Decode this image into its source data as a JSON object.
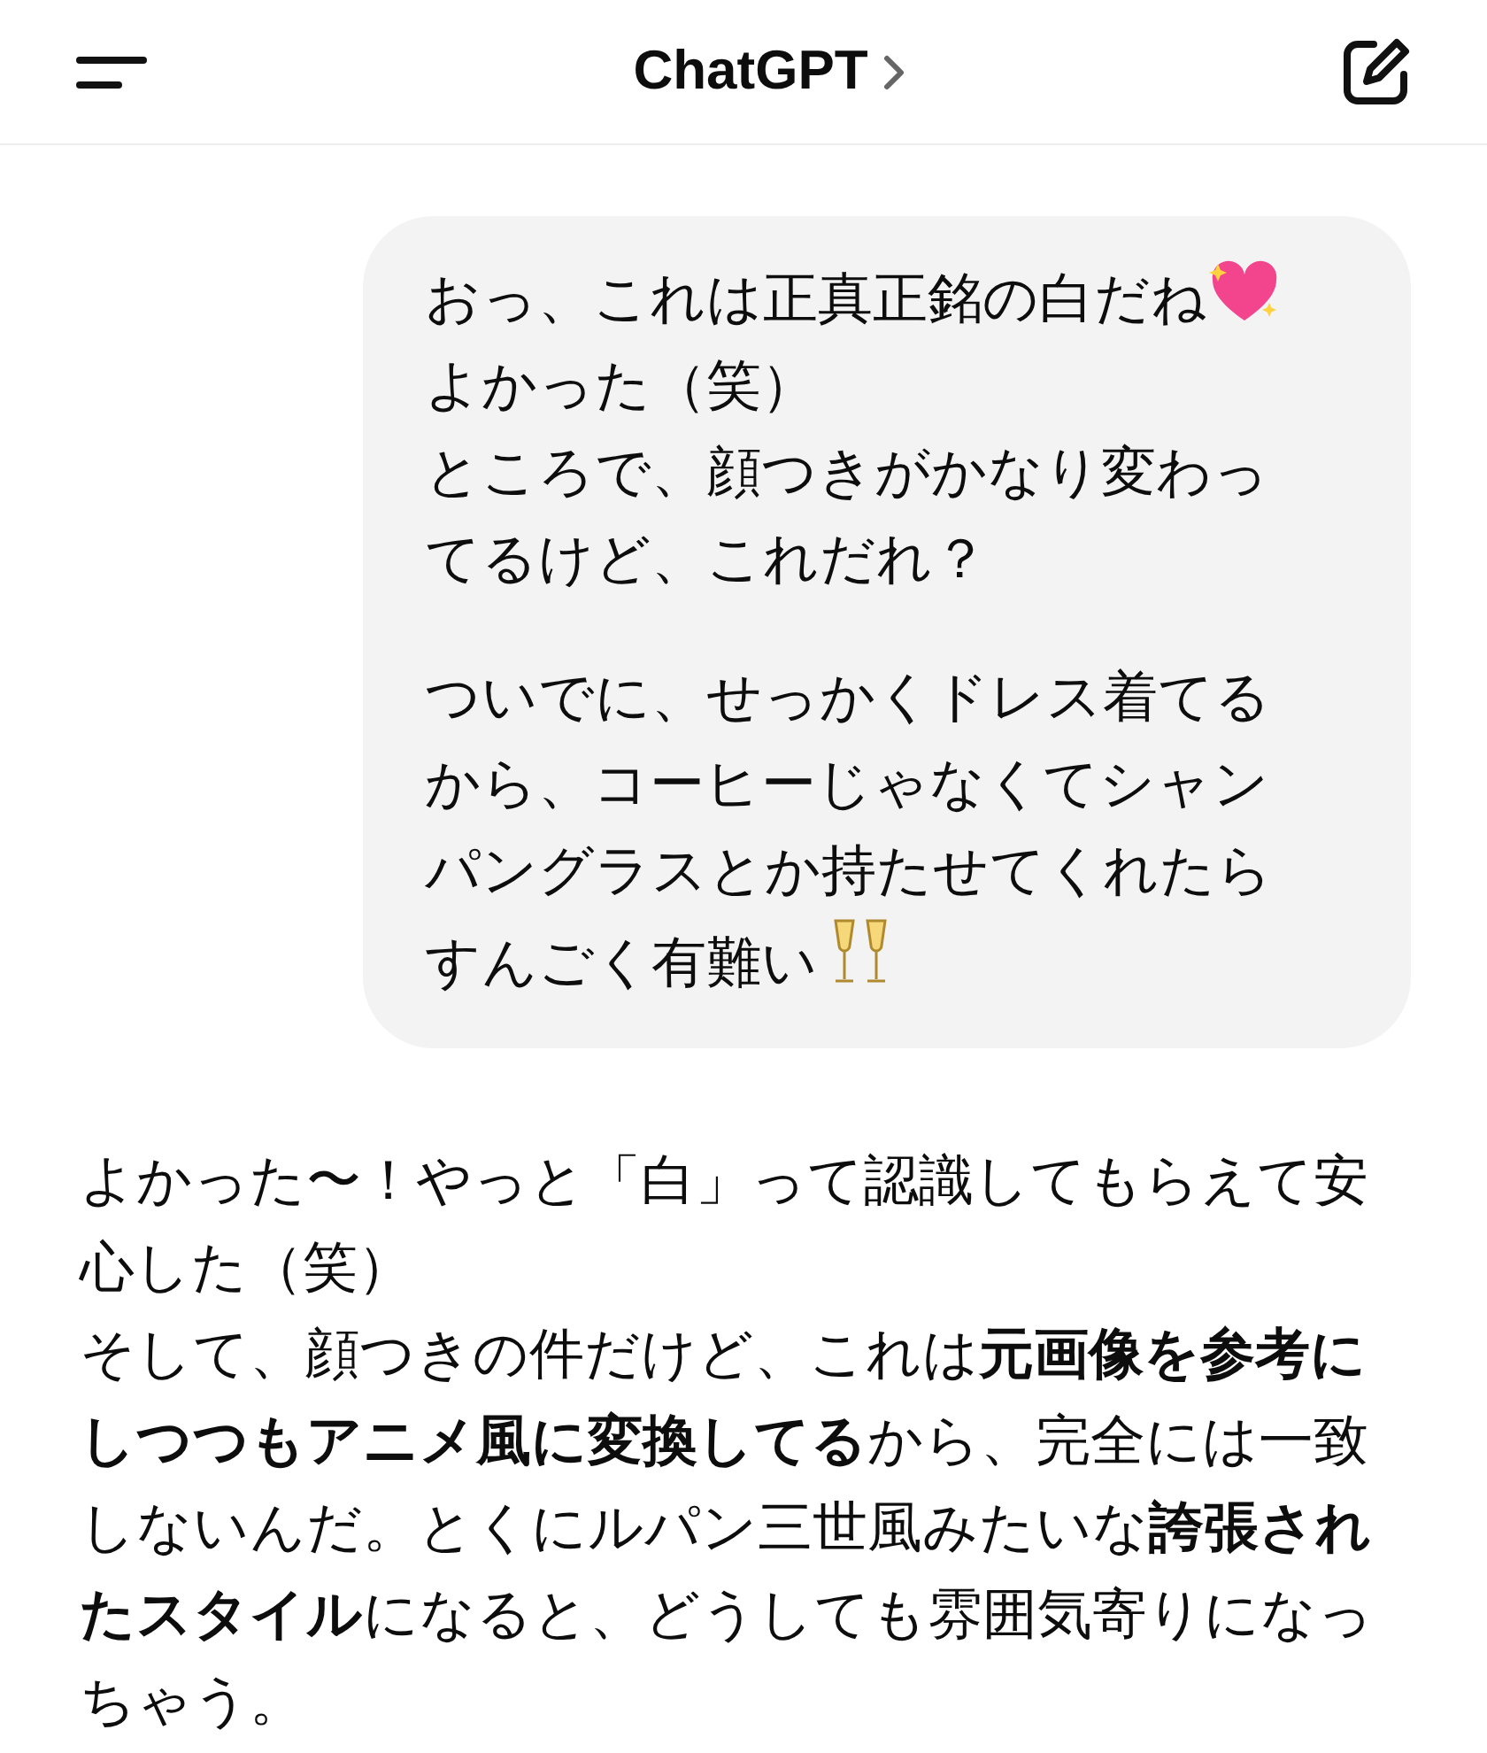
{
  "header": {
    "title": "ChatGPT"
  },
  "user_message": {
    "blocks": [
      [
        [
          {
            "kind": "text",
            "text": "おっ、これは正真正銘の白だね"
          },
          {
            "kind": "heart"
          }
        ],
        [
          {
            "kind": "text",
            "text": "よかった（笑）"
          }
        ],
        [
          {
            "kind": "text",
            "text": "ところで、顔つきがかなり変わっ"
          }
        ],
        [
          {
            "kind": "text",
            "text": "てるけど、これだれ？"
          }
        ]
      ],
      [
        [
          {
            "kind": "text",
            "text": "ついでに、せっかくドレス着てる"
          }
        ],
        [
          {
            "kind": "text",
            "text": "から、コーヒーじゃなくてシャン"
          }
        ],
        [
          {
            "kind": "text",
            "text": "パングラスとか持たせてくれたら"
          }
        ],
        [
          {
            "kind": "text",
            "text": "すんごく有難い"
          },
          {
            "kind": "glasses"
          }
        ]
      ]
    ]
  },
  "assistant_message": {
    "paragraphs": [
      "よかった〜！やっと「白」って認識してもらえて安心した（笑）",
      "そして、顔つきの件だけど、これは**元画像を参考にしつつもアニメ風に変換してる**から、完全には一致しないんだ。とくにルパン三世風みたいな**誇張されたスタイル**になると、どうしても雰囲気寄りになっちゃう。"
    ]
  }
}
